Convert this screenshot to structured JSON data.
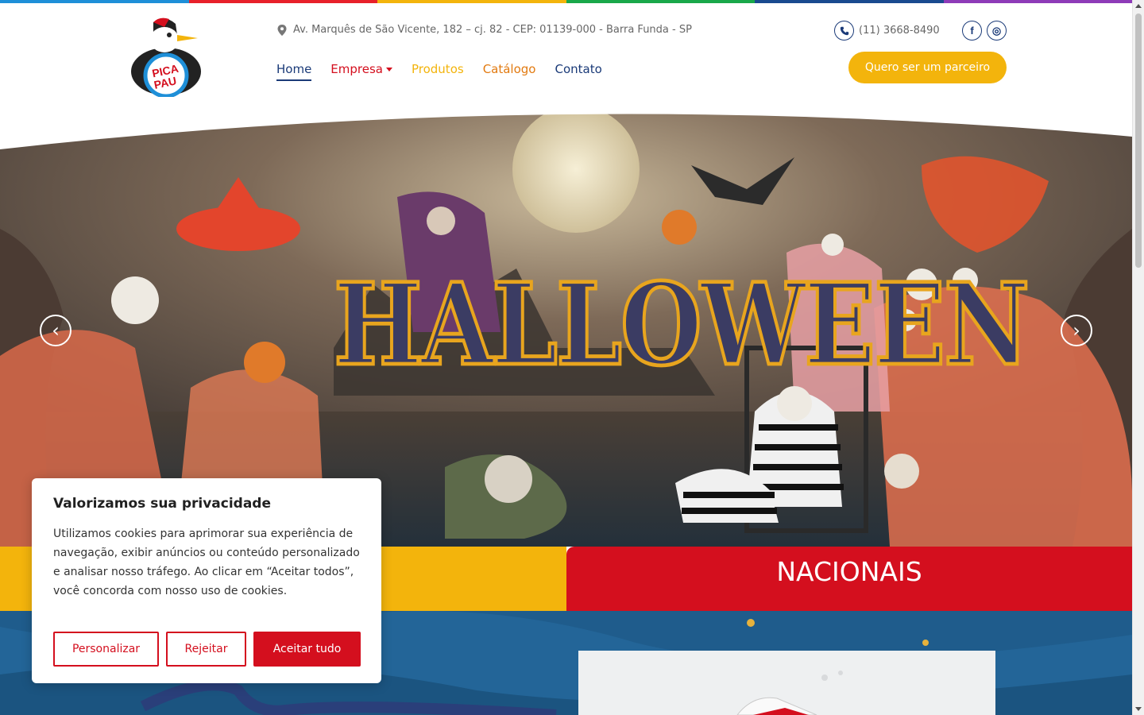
{
  "colors": {
    "rainbow": [
      "#1e8fd8",
      "#e8202a",
      "#f3b40c",
      "#1aa84a",
      "#1a4a8f",
      "#8e3bb8"
    ],
    "primary_red": "#d40f1e",
    "yellow": "#f3b40c",
    "navy": "#1a3a78"
  },
  "brand": {
    "logo_text_top": "PICA",
    "logo_text_bottom": "PAU"
  },
  "header": {
    "address": "Av. Marquês de São Vicente, 182 – cj. 82 - CEP: 01139-000 - Barra Funda - SP",
    "phone": "(11) 3668-8490",
    "partner_button": "Quero ser um parceiro",
    "socials": [
      {
        "icon": "facebook-icon",
        "glyph": "f"
      },
      {
        "icon": "instagram-icon",
        "glyph": "◎"
      }
    ]
  },
  "nav": [
    {
      "label": "Home"
    },
    {
      "label": "Empresa"
    },
    {
      "label": "Produtos"
    },
    {
      "label": "Catálogo"
    },
    {
      "label": "Contato"
    }
  ],
  "hero": {
    "title": "HALLOWEEN",
    "prev_glyph": "‹",
    "next_glyph": "›"
  },
  "sections": {
    "red_label": "NACIONAIS"
  },
  "cookie": {
    "title": "Valorizamos sua privacidade",
    "text": "Utilizamos cookies para aprimorar sua experiência de navegação, exibir anúncios ou conteúdo personalizado e analisar nosso tráfego. Ao clicar em “Aceitar todos”, você concorda com nosso uso de cookies.",
    "customize": "Personalizar",
    "reject": "Rejeitar",
    "accept": "Aceitar tudo"
  }
}
